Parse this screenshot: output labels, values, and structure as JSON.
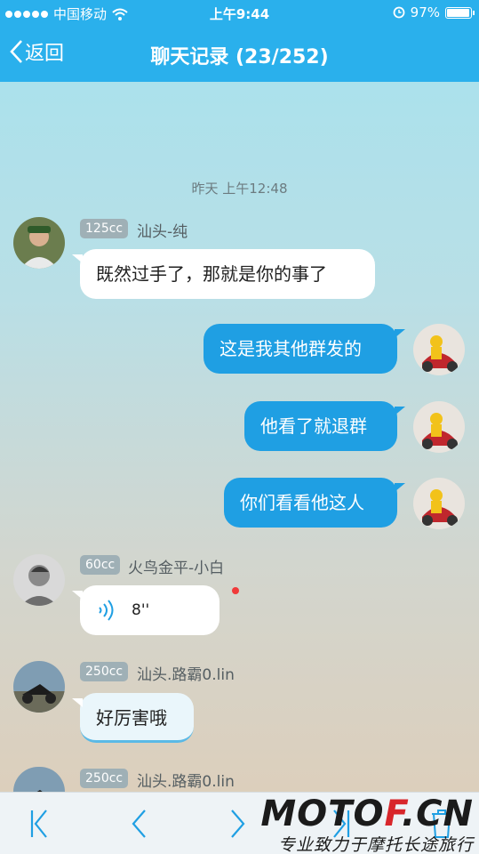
{
  "status_bar": {
    "carrier": "中国移动",
    "time": "上午9:44",
    "battery": "97%"
  },
  "nav": {
    "back_label": "返回",
    "title": "聊天记录 (23/252)"
  },
  "timestamp": "昨天 上午12:48",
  "messages": [
    {
      "badge": "125cc",
      "sender": "汕头-纯",
      "text": "既然过手了，那就是你的事了"
    },
    {
      "text": "这是我其他群发的"
    },
    {
      "text": "他看了就退群"
    },
    {
      "text": "你们看看他这人"
    },
    {
      "badge": "60cc",
      "sender": "火鸟金平-小白",
      "voice_duration": "8''"
    },
    {
      "badge": "250cc",
      "sender": "汕头.路霸0.lin",
      "text": "好厉害哦"
    },
    {
      "badge": "250cc",
      "sender": "汕头.路霸0.lin"
    }
  ],
  "watermark": {
    "logo_main": "MOTO",
    "logo_accent": "F",
    "logo_tail": ".CN",
    "slogan": "专业致力于摩托长途旅行"
  },
  "colors": {
    "brand": "#2ab0ec",
    "outgoing_bubble": "#1f9fe3",
    "unread_dot": "#f03a3a"
  }
}
